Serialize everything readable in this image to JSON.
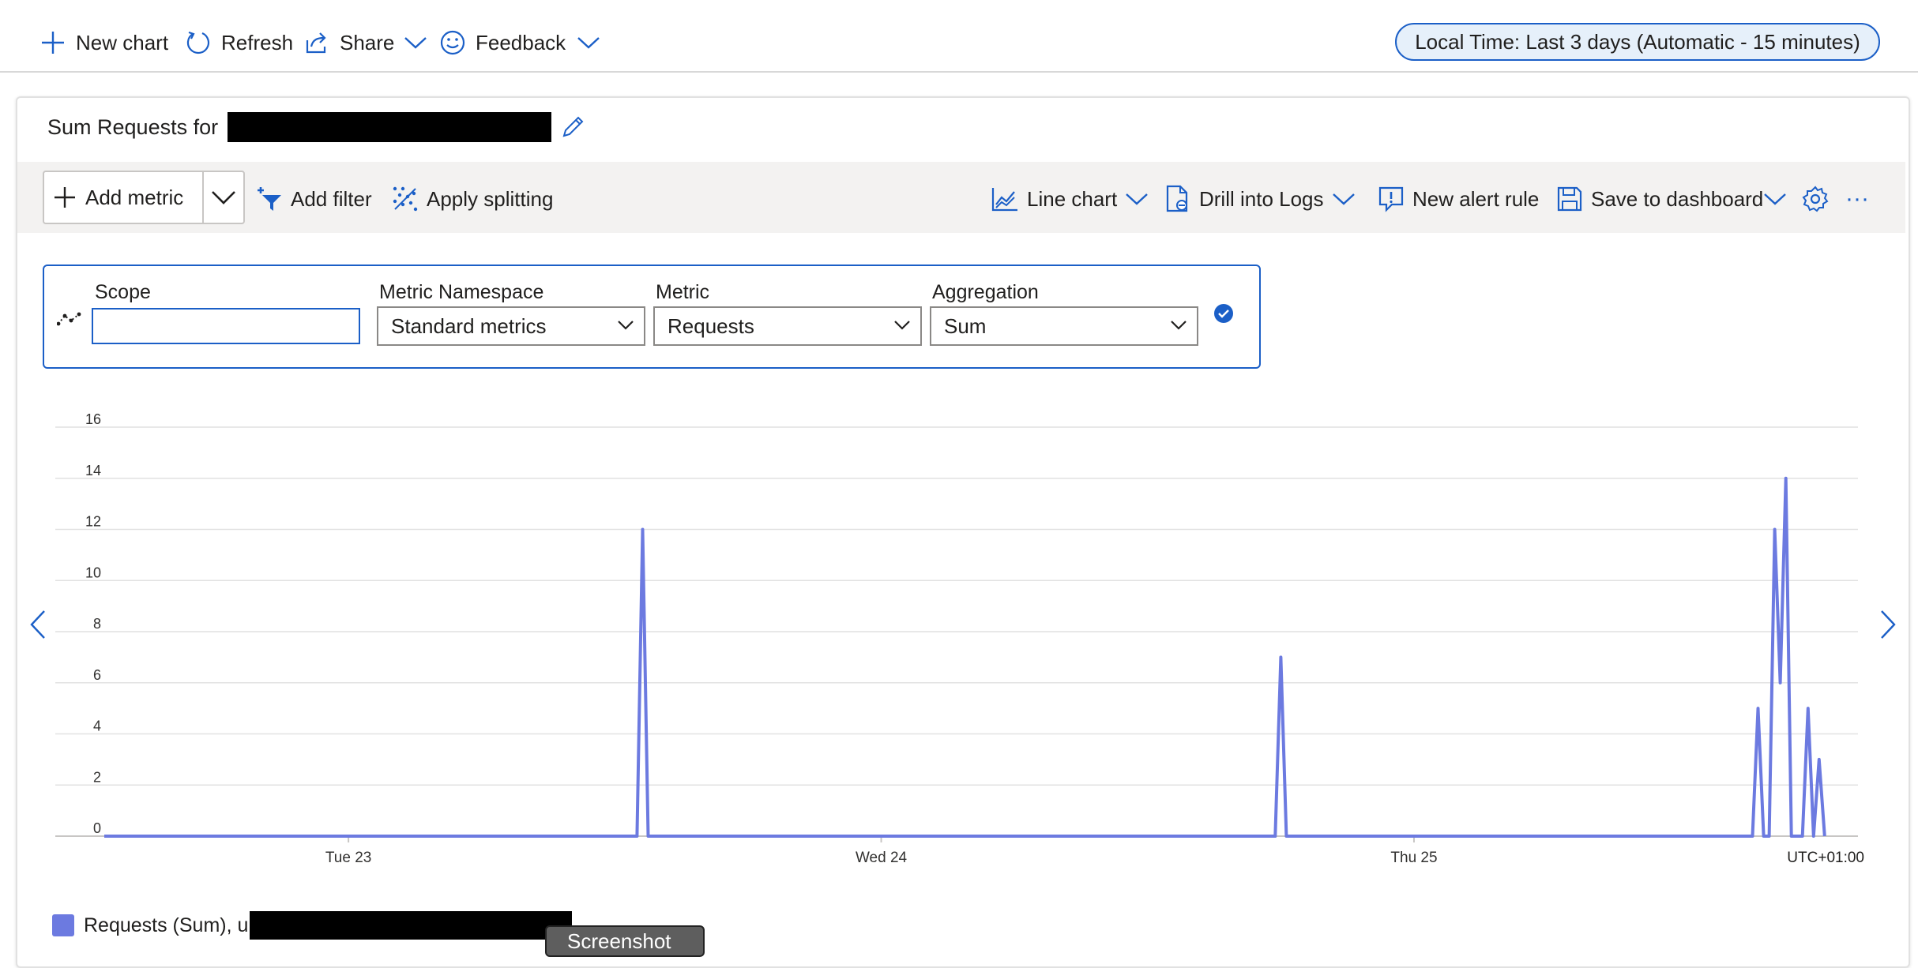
{
  "toolbar_top": {
    "new_chart": "New chart",
    "refresh": "Refresh",
    "share": "Share",
    "feedback": "Feedback",
    "time_range": "Local Time: Last 3 days (Automatic - 15 minutes)"
  },
  "card": {
    "title_prefix": "Sum Requests for"
  },
  "chart_toolbar": {
    "add_metric": "Add metric",
    "add_filter": "Add filter",
    "apply_splitting": "Apply splitting",
    "line_chart": "Line chart",
    "drill_into_logs": "Drill into Logs",
    "new_alert_rule": "New alert rule",
    "save_to_dashboard": "Save to dashboard",
    "more": "···"
  },
  "metric_selector": {
    "scope_label": "Scope",
    "scope_value": "",
    "namespace_label": "Metric Namespace",
    "namespace_value": "Standard metrics",
    "metric_label": "Metric",
    "metric_value": "Requests",
    "aggregation_label": "Aggregation",
    "aggregation_value": "Sum"
  },
  "colors": {
    "accent": "#1b5fc7",
    "series": "#6c7ae0",
    "grid": "#e1e1e1"
  },
  "chart_data": {
    "type": "line",
    "title": "",
    "xlabel": "",
    "ylabel": "",
    "ylim": [
      0,
      16
    ],
    "yticks": [
      0,
      2,
      4,
      6,
      8,
      10,
      12,
      14,
      16
    ],
    "xlim": [
      "2023-01-22T13:00",
      "2023-01-25T20:00"
    ],
    "xtick_labels": [
      {
        "label": "Tue 23",
        "x": "2023-01-23T00:00"
      },
      {
        "label": "Wed 24",
        "x": "2023-01-24T00:00"
      },
      {
        "label": "Thu 25",
        "x": "2023-01-25T00:00"
      }
    ],
    "timezone_label": "UTC+01:00",
    "grid": true,
    "legend": "bottom-left",
    "series": [
      {
        "name": "Requests (Sum), u",
        "points": [
          {
            "x": "2023-01-22T13:00",
            "y": 0
          },
          {
            "x": "2023-01-23T13:00",
            "y": 0
          },
          {
            "x": "2023-01-23T13:15",
            "y": 12
          },
          {
            "x": "2023-01-23T13:30",
            "y": 0
          },
          {
            "x": "2023-01-24T17:45",
            "y": 0
          },
          {
            "x": "2023-01-24T18:00",
            "y": 7
          },
          {
            "x": "2023-01-24T18:15",
            "y": 0
          },
          {
            "x": "2023-01-25T15:15",
            "y": 0
          },
          {
            "x": "2023-01-25T15:30",
            "y": 5
          },
          {
            "x": "2023-01-25T15:45",
            "y": 0
          },
          {
            "x": "2023-01-25T16:00",
            "y": 0
          },
          {
            "x": "2023-01-25T16:15",
            "y": 12
          },
          {
            "x": "2023-01-25T16:30",
            "y": 6
          },
          {
            "x": "2023-01-25T16:45",
            "y": 14
          },
          {
            "x": "2023-01-25T17:00",
            "y": 0
          },
          {
            "x": "2023-01-25T17:30",
            "y": 0
          },
          {
            "x": "2023-01-25T17:45",
            "y": 5
          },
          {
            "x": "2023-01-25T18:00",
            "y": 0
          },
          {
            "x": "2023-01-25T18:15",
            "y": 3
          },
          {
            "x": "2023-01-25T18:30",
            "y": 0
          }
        ]
      }
    ]
  },
  "overlay": {
    "tooltip_text": "Screenshot"
  }
}
